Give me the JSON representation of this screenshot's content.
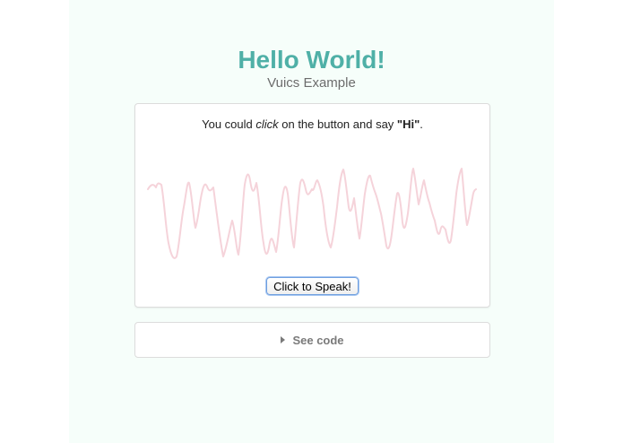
{
  "header": {
    "title": "Hello World!",
    "subtitle": "Vuics Example"
  },
  "card": {
    "instruction": {
      "prefix": "You could ",
      "emphasis": "click",
      "middle": " on the button and say ",
      "keyword": "\"Hi\"",
      "suffix": "."
    },
    "speak_button": "Click to Speak!"
  },
  "code_panel": {
    "label": "See code",
    "icon": "triangle-right-icon"
  },
  "colors": {
    "title": "#4fb0a7",
    "page_background": "#f6fefa",
    "waveform": "#f5d3da"
  }
}
